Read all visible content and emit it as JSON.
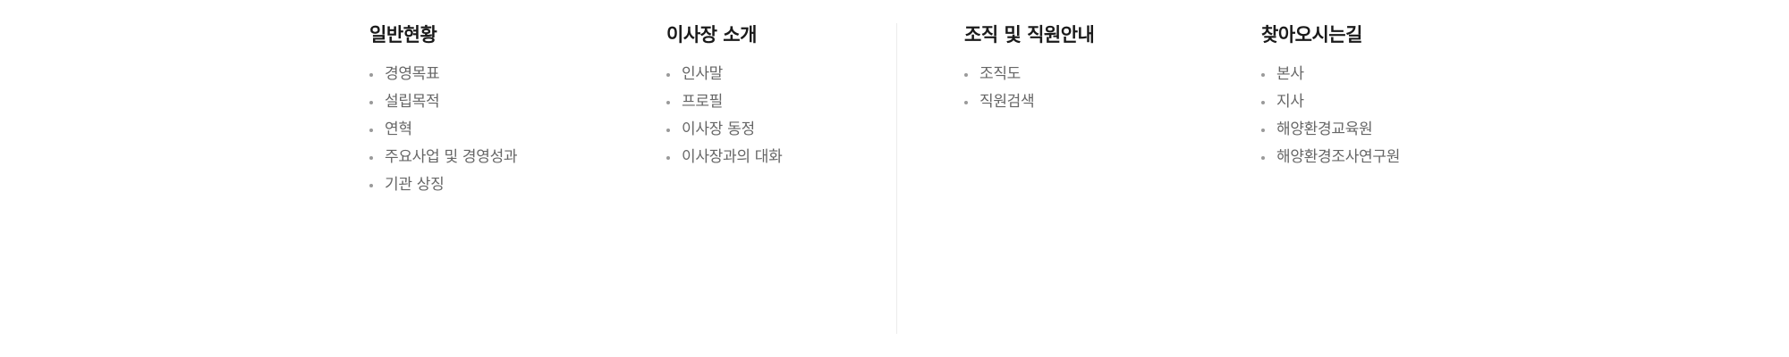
{
  "menu": {
    "columns": [
      {
        "title": "일반현황",
        "items": [
          "경영목표",
          "설립목적",
          "연혁",
          "주요사업 및 경영성과",
          "기관 상징"
        ]
      },
      {
        "title": "이사장 소개",
        "items": [
          "인사말",
          "프로필",
          "이사장 동정",
          "이사장과의 대화"
        ]
      },
      {
        "title": "조직 및 직원안내",
        "items": [
          "조직도",
          "직원검색"
        ]
      },
      {
        "title": "찾아오시는길",
        "items": [
          "본사",
          "지사",
          "해양환경교육원",
          "해양환경조사연구원"
        ]
      }
    ]
  }
}
